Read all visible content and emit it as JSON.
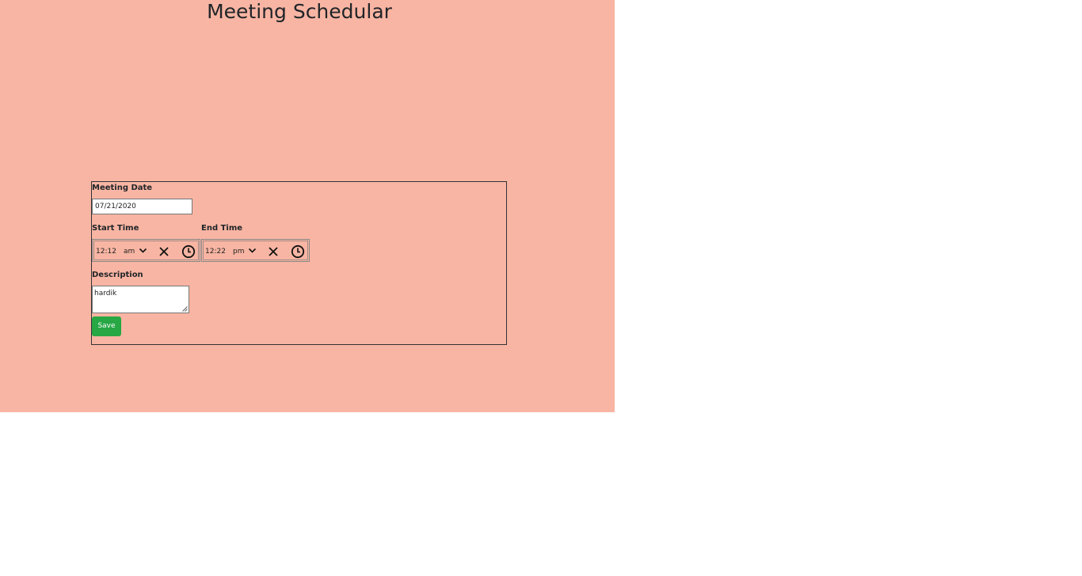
{
  "page": {
    "title": "Meeting Schedular",
    "background_color": "#f8b5a3"
  },
  "form": {
    "date_label": "Meeting Date",
    "date_value": "07/21/2020",
    "start_label": "Start Time",
    "start_time": {
      "value": "12:12",
      "period": "am"
    },
    "end_label": "End Time",
    "end_time": {
      "value": "12:22",
      "period": "pm"
    },
    "description_label": "Description",
    "description_value": "hardik",
    "save_label": "Save",
    "save_color": "#28a745"
  }
}
